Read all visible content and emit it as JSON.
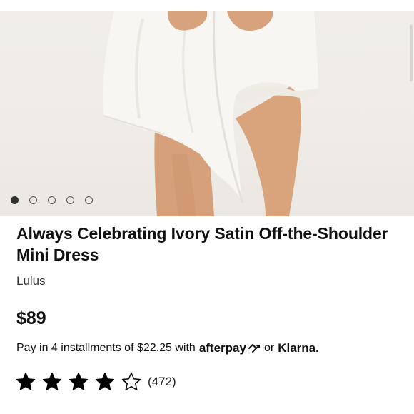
{
  "product_image": {
    "alt": "product-photo",
    "carousel": {
      "total": 5,
      "active_index": 0
    }
  },
  "product": {
    "title": "Always Celebrating Ivory Satin Off-the-Shoulder Mini Dress",
    "brand": "Lulus",
    "price": "$89"
  },
  "payment": {
    "installment_text": "Pay in 4 installments of $22.25 with",
    "afterpay_label": "afterpay",
    "or_label": "or",
    "klarna_label": "Klarna."
  },
  "rating": {
    "filled_stars": 4,
    "total_stars": 5,
    "count_text": "(472)"
  },
  "colors": {
    "text": "#111111",
    "background": "#ffffff",
    "dress": "#f7f5f1",
    "skin": "#d9a27a"
  }
}
